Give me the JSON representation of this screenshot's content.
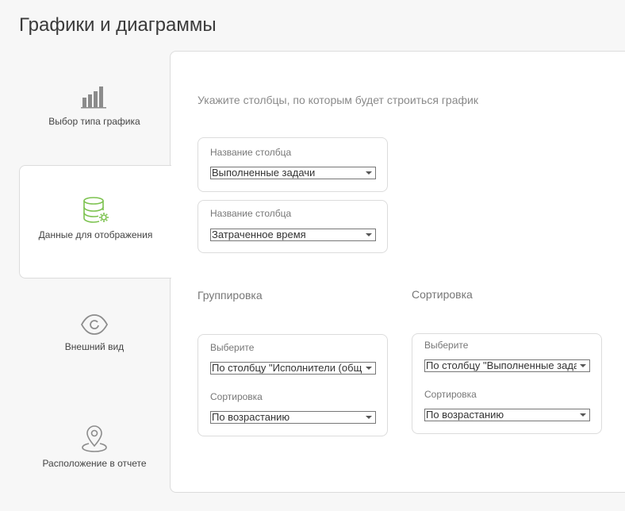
{
  "page": {
    "title": "Графики и диаграммы"
  },
  "steps": [
    {
      "label": "Выбор типа графика",
      "icon": "bar-chart-icon"
    },
    {
      "label": "Данные для отображения",
      "icon": "database-settings-icon",
      "active": true,
      "accent": "#7cc24f"
    },
    {
      "label": "Внешний вид",
      "icon": "eye-icon"
    },
    {
      "label": "Расположение в отчете",
      "icon": "location-pin-icon"
    }
  ],
  "main": {
    "intro": "Укажите столбцы, по которым будет строиться график",
    "columns": [
      {
        "label": "Название столбца",
        "value": "Выполненные задачи"
      },
      {
        "label": "Название столбца",
        "value": "Затраченное время"
      }
    ],
    "grouping": {
      "title": "Группировка",
      "select_label": "Выберите",
      "select_value": "По столбцу \"Исполнители (общ",
      "sort_label": "Сортировка",
      "sort_value": "По возрастанию"
    },
    "sorting": {
      "title": "Сортировка",
      "select_label": "Выберите",
      "select_value": "По столбцу \"Выполненные зада",
      "sort_label": "Сортировка",
      "sort_value": "По возрастанию"
    }
  }
}
